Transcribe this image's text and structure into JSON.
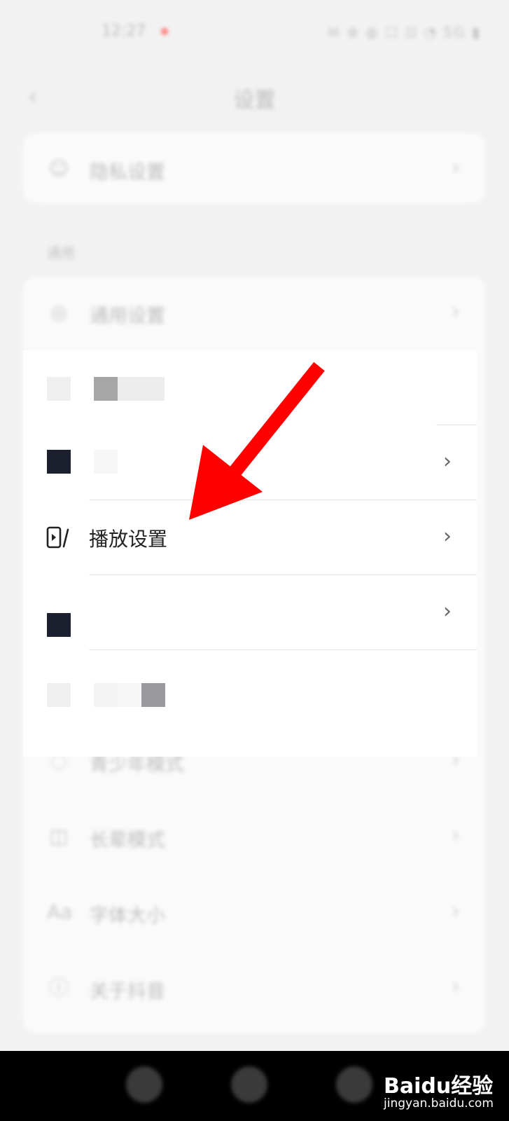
{
  "status_bar": {
    "time": "12:27",
    "icons": "✉ ⊕ ◍ ☐ ⊡ ◔ 5G ▮"
  },
  "header": {
    "back": "‹",
    "title": "设置"
  },
  "card1": {
    "label": "隐私设置"
  },
  "section": {
    "label": "通用"
  },
  "rows": [
    {
      "label": "通用设置"
    },
    {
      "label": "播放设置"
    },
    {
      "label": "青少年模式"
    },
    {
      "label": "长辈模式"
    },
    {
      "label": "字体大小"
    },
    {
      "label": "关于抖音"
    }
  ],
  "highlight": {
    "play_label": "播放设置"
  },
  "chevron": "›",
  "watermark": {
    "brand": "Baidu经验",
    "url": "jingyan.baidu.com"
  },
  "colors": {
    "arrow": "#ff0000"
  }
}
